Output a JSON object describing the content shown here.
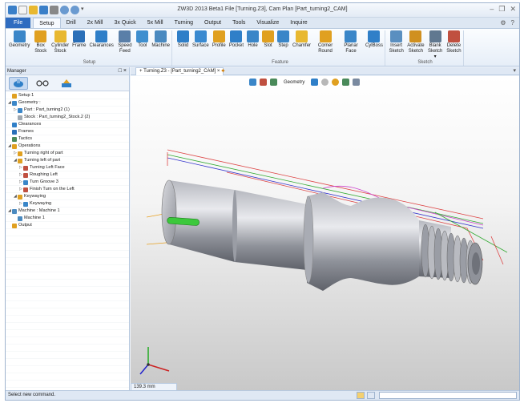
{
  "app": {
    "title": "ZW3D 2013 Beta1      File [Turning.Z3],  Cam Plan [Part_turning2_CAM]",
    "help_label": "?"
  },
  "tabs": [
    "File",
    "Setup",
    "Drill",
    "2x Mill",
    "3x Quick",
    "5x Mill",
    "Turning",
    "Output",
    "Tools",
    "Visualize",
    "Inquire"
  ],
  "active_tab": "Setup",
  "ribbon": {
    "setup_group": {
      "label": "Setup",
      "buttons": [
        {
          "label": "Geometry",
          "icon": "geometry-icon",
          "color": "#3a86c8"
        },
        {
          "label": "Box Stock",
          "icon": "box-stock-icon",
          "color": "#e0a020"
        },
        {
          "label": "Cylinder Stock",
          "icon": "cylinder-stock-icon",
          "color": "#e8b830"
        },
        {
          "label": "Frame",
          "icon": "frame-icon",
          "color": "#2a6fb8"
        },
        {
          "label": "Clearances",
          "icon": "clearances-icon",
          "color": "#2f7fc8"
        },
        {
          "label": "Speed Feed",
          "icon": "speed-feed-icon",
          "color": "#5a7fa8"
        },
        {
          "label": "Tool",
          "icon": "tool-icon",
          "color": "#3f8fcf"
        },
        {
          "label": "Machine",
          "icon": "machine-icon",
          "color": "#4a8ac0"
        }
      ]
    },
    "feature_group": {
      "label": "Feature",
      "buttons": [
        {
          "label": "Solid",
          "icon": "solid-icon",
          "color": "#2f7fc8"
        },
        {
          "label": "Surface",
          "icon": "surface-icon",
          "color": "#3a8ad0"
        },
        {
          "label": "Profile",
          "icon": "profile-icon",
          "color": "#e0a020"
        },
        {
          "label": "Pocket",
          "icon": "pocket-icon",
          "color": "#2f7fc8"
        },
        {
          "label": "Hole",
          "icon": "hole-icon",
          "color": "#3a86c8"
        },
        {
          "label": "Slot",
          "icon": "slot-icon",
          "color": "#e0a020"
        },
        {
          "label": "Step",
          "icon": "step-icon",
          "color": "#3a86c8"
        },
        {
          "label": "Chamfer",
          "icon": "chamfer-icon",
          "color": "#e8b830"
        },
        {
          "label": "Corner Round",
          "icon": "corner-round-icon",
          "color": "#e0a020"
        },
        {
          "label": "Planar Face",
          "icon": "planar-face-icon",
          "color": "#3a86c8"
        },
        {
          "label": "CylBoss",
          "icon": "cylboss-icon",
          "color": "#2f7fc8"
        }
      ]
    },
    "sketch_group": {
      "label": "Sketch",
      "buttons": [
        {
          "label": "Insert Sketch",
          "icon": "insert-sketch-icon",
          "color": "#5a8fc0"
        },
        {
          "label": "Activate Sketch",
          "icon": "activate-sketch-icon",
          "color": "#d09020"
        },
        {
          "label": "Blank Sketch ▾",
          "icon": "blank-sketch-icon",
          "color": "#607890"
        },
        {
          "label": "Delete Sketch",
          "icon": "delete-sketch-icon",
          "color": "#c05040"
        }
      ]
    }
  },
  "manager": {
    "title": "Manager",
    "controls": "□ ×",
    "tree": [
      {
        "label": "Setup 1",
        "level": 0,
        "toggle": "",
        "color": "#e0a020"
      },
      {
        "label": "Geometry :",
        "level": 0,
        "toggle": "◢",
        "color": "#3a86c8"
      },
      {
        "label": "Part : Part_turning2 (1)",
        "level": 1,
        "toggle": "▷",
        "color": "#3a86c8"
      },
      {
        "label": "Stock : Part_turning2_Stock.2 (2)",
        "level": 1,
        "toggle": "",
        "color": "#a0a8b0"
      },
      {
        "label": "Clearances",
        "level": 0,
        "toggle": "",
        "color": "#2f7fc8"
      },
      {
        "label": "Frames",
        "level": 0,
        "toggle": "",
        "color": "#2a6fb8"
      },
      {
        "label": "Tactics",
        "level": 0,
        "toggle": "",
        "color": "#4a8a5a"
      },
      {
        "label": "Operations",
        "level": 0,
        "toggle": "◢",
        "color": "#e0a020"
      },
      {
        "label": "Turning right of part",
        "level": 1,
        "toggle": "▷",
        "color": "#e0a020"
      },
      {
        "label": "Turning left of part",
        "level": 1,
        "toggle": "◢",
        "color": "#e0a020"
      },
      {
        "label": "Turning Left Face",
        "level": 2,
        "toggle": "▷",
        "color": "#c05040"
      },
      {
        "label": "Roughing Left",
        "level": 2,
        "toggle": "▷",
        "color": "#c05040"
      },
      {
        "label": "Turn Groove 3",
        "level": 2,
        "toggle": "▷",
        "color": "#3a86c8"
      },
      {
        "label": "Finish Turn on the Left",
        "level": 2,
        "toggle": "▷",
        "color": "#c05040"
      },
      {
        "label": "Keywaying",
        "level": 1,
        "toggle": "◢",
        "color": "#e0a020"
      },
      {
        "label": "Keywaying",
        "level": 2,
        "toggle": "▷",
        "color": "#3a86c8"
      },
      {
        "label": "Machine : Machine 1",
        "level": 0,
        "toggle": "◢",
        "color": "#4a8ac0"
      },
      {
        "label": "Machine 1",
        "level": 1,
        "toggle": "",
        "color": "#4a8ac0"
      },
      {
        "label": "Output",
        "level": 0,
        "toggle": "",
        "color": "#e0a020"
      }
    ]
  },
  "document_tab": {
    "label": "Turning.Z3 - [Part_turning2_CAM]",
    "close": "×",
    "pin": "+",
    "add": "✦"
  },
  "view_toolbar": {
    "geometry_label": "Geometry"
  },
  "viewport": {
    "scale_text": "139.3 mm"
  },
  "status": {
    "text": "Select new command."
  },
  "colors": {
    "accent": "#2f6cc0",
    "ribbon_bg": "#eef3fa",
    "viewport_top": "#ffffff",
    "viewport_bottom": "#c8c8c8"
  }
}
